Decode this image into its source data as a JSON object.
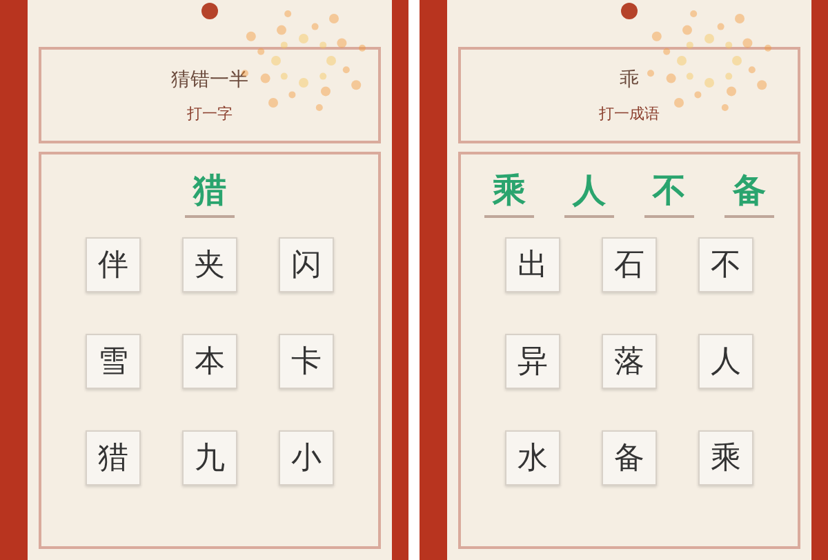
{
  "panels": [
    {
      "riddle": "猜错一半",
      "hint": "打一字",
      "answer": [
        {
          "char": "猎"
        }
      ],
      "tiles": [
        "伴",
        "夹",
        "闪",
        "雪",
        "本",
        "卡",
        "猎",
        "九",
        "小"
      ]
    },
    {
      "riddle": "乖",
      "hint": "打一成语",
      "answer": [
        {
          "char": "乘"
        },
        {
          "char": "人"
        },
        {
          "char": "不"
        },
        {
          "char": "备"
        }
      ],
      "tiles": [
        "出",
        "石",
        "不",
        "异",
        "落",
        "人",
        "水",
        "备",
        "乘"
      ]
    }
  ]
}
